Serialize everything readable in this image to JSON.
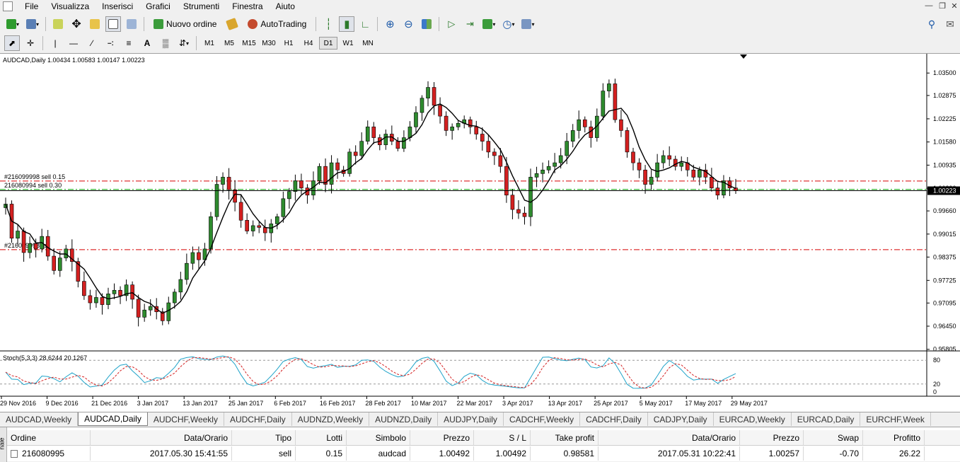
{
  "menu": {
    "items": [
      "File",
      "Visualizza",
      "Inserisci",
      "Grafici",
      "Strumenti",
      "Finestra",
      "Aiuto"
    ]
  },
  "toolbar": {
    "new_order": "Nuovo ordine",
    "autotrading": "AutoTrading"
  },
  "timeframes": [
    "M1",
    "M5",
    "M15",
    "M30",
    "H1",
    "H4",
    "D1",
    "W1",
    "MN"
  ],
  "active_timeframe": "D1",
  "chart": {
    "header": "AUDCAD,Daily  1.00434 1.00583 1.00147 1.00223",
    "indicator_label": "Stoch(5,3,3) 28.6244 20.1267",
    "current_price_label": "1.00223",
    "order_lines": [
      {
        "label": "#216099998 sell 0.15",
        "price": 1.00492,
        "color": "#d60000"
      },
      {
        "label": "216080994 sell 0.30",
        "price": 1.00257,
        "color": "#00a000"
      },
      {
        "label": "#216099998 tp",
        "price": 0.98581,
        "color": "#d60000"
      }
    ]
  },
  "chart_data": {
    "type": "candlestick",
    "symbol": "AUDCAD",
    "timeframe": "Daily",
    "ylim": [
      0.958,
      1.038
    ],
    "price_ticks": [
      "1.03500",
      "1.02875",
      "1.02225",
      "1.01580",
      "1.00935",
      "1.00290",
      "0.99660",
      "0.99015",
      "0.98375",
      "0.97725",
      "0.97095",
      "0.96450",
      "0.95805"
    ],
    "date_ticks": [
      "29 Nov 2016",
      "9 Dec 2016",
      "21 Dec 2016",
      "3 Jan 2017",
      "13 Jan 2017",
      "25 Jan 2017",
      "6 Feb 2017",
      "16 Feb 2017",
      "28 Feb 2017",
      "10 Mar 2017",
      "22 Mar 2017",
      "3 Apr 2017",
      "13 Apr 2017",
      "25 Apr 2017",
      "5 May 2017",
      "17 May 2017",
      "29 May 2017"
    ],
    "stoch_ticks": [
      "80",
      "20",
      "0"
    ],
    "closes": [
      0.9985,
      0.989,
      0.991,
      0.985,
      0.9875,
      0.986,
      0.9895,
      0.984,
      0.98,
      0.9835,
      0.986,
      0.9825,
      0.977,
      0.973,
      0.971,
      0.9725,
      0.9705,
      0.9735,
      0.9745,
      0.973,
      0.976,
      0.972,
      0.967,
      0.969,
      0.97,
      0.9685,
      0.966,
      0.971,
      0.974,
      0.9775,
      0.982,
      0.985,
      0.983,
      0.986,
      0.995,
      1.004,
      1.006,
      1.0025,
      0.999,
      0.994,
      0.991,
      0.9925,
      0.992,
      0.9905,
      0.993,
      0.995,
      1.0,
      1.002,
      1.005,
      1.003,
      1.001,
      1.005,
      1.009,
      1.004,
      1.01,
      1.008,
      1.007,
      1.013,
      1.012,
      1.016,
      1.02,
      1.017,
      1.015,
      1.018,
      1.016,
      1.014,
      1.017,
      1.02,
      1.024,
      1.028,
      1.031,
      1.026,
      1.023,
      1.019,
      1.02,
      1.021,
      1.022,
      1.02,
      1.018,
      1.016,
      1.013,
      1.012,
      1.009,
      1.001,
      0.997,
      0.996,
      0.995,
      1.006,
      1.007,
      1.008,
      1.009,
      1.01,
      1.012,
      1.016,
      1.019,
      1.022,
      1.02,
      1.017,
      1.023,
      1.03,
      1.032,
      1.022,
      1.019,
      1.013,
      1.01,
      1.008,
      1.004,
      1.006,
      1.01,
      1.012,
      1.011,
      1.009,
      1.01,
      1.008,
      1.006,
      1.008,
      1.006,
      1.003,
      1.001,
      1.005,
      1.003,
      1.0022
    ],
    "series": [
      {
        "name": "MA",
        "type": "line"
      },
      {
        "name": "Stoch(5,3,3)",
        "type": "oscillator"
      }
    ]
  },
  "symbol_tabs": [
    "AUDCAD,Weekly",
    "AUDCAD,Daily",
    "AUDCHF,Weekly",
    "AUDCHF,Daily",
    "AUDNZD,Weekly",
    "AUDNZD,Daily",
    "AUDJPY,Daily",
    "CADCHF,Weekly",
    "CADCHF,Daily",
    "CADJPY,Daily",
    "EURCAD,Weekly",
    "EURCAD,Daily",
    "EURCHF,Week"
  ],
  "active_symbol_tab": "AUDCAD,Daily",
  "terminal": {
    "columns": [
      "Ordine",
      "Data/Orario",
      "Tipo",
      "Lotti",
      "Simbolo",
      "Prezzo",
      "S / L",
      "Take profit",
      "Data/Orario",
      "Prezzo",
      "Swap",
      "Profitto"
    ],
    "rows": [
      [
        "216080995",
        "2017.05.30 15:41:55",
        "sell",
        "0.15",
        "audcad",
        "1.00492",
        "1.00492",
        "0.98581",
        "2017.05.31 10:22:41",
        "1.00257",
        "-0.70",
        "26.22"
      ]
    ],
    "side_label": "nale"
  }
}
